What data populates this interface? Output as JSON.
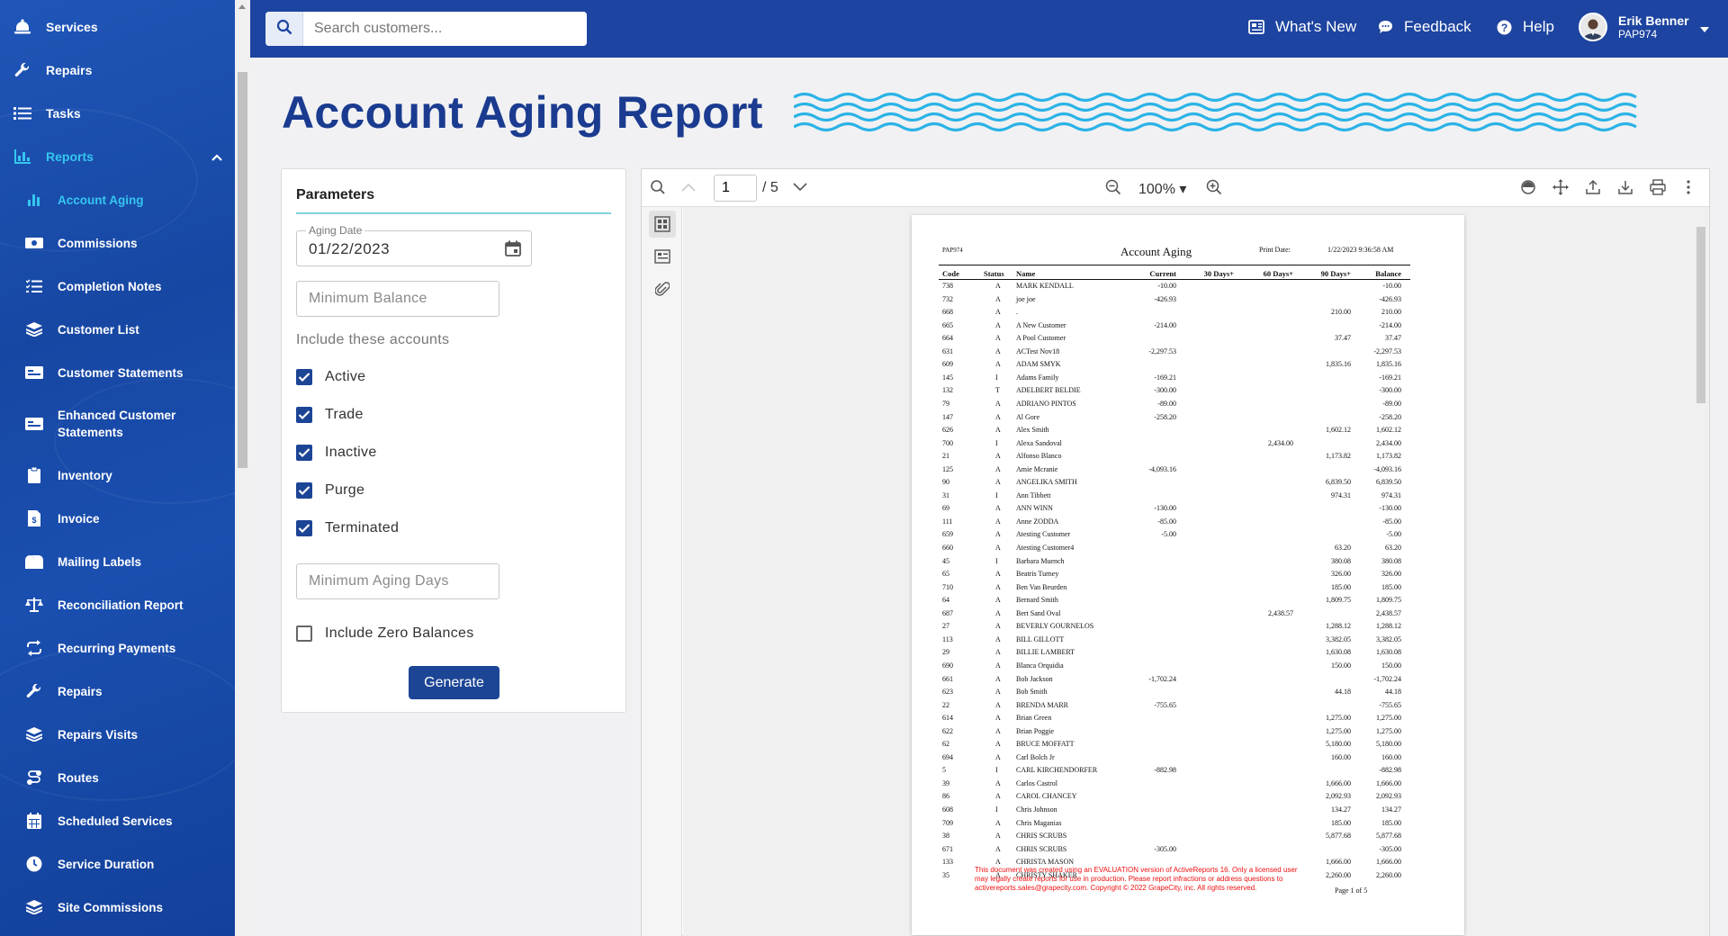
{
  "sidebar": {
    "top_items": [
      {
        "label": "Services",
        "icon": "bell-icon"
      },
      {
        "label": "Repairs",
        "icon": "wrench-icon"
      },
      {
        "label": "Tasks",
        "icon": "list-icon"
      },
      {
        "label": "Reports",
        "icon": "chart-icon"
      }
    ],
    "report_items": [
      {
        "label": "Account Aging"
      },
      {
        "label": "Commissions"
      },
      {
        "label": "Completion Notes"
      },
      {
        "label": "Customer List"
      },
      {
        "label": "Customer Statements"
      },
      {
        "label": "Enhanced Customer Statements"
      },
      {
        "label": "Inventory"
      },
      {
        "label": "Invoice"
      },
      {
        "label": "Mailing Labels"
      },
      {
        "label": "Reconciliation Report"
      },
      {
        "label": "Recurring Payments"
      },
      {
        "label": "Repairs"
      },
      {
        "label": "Repairs Visits"
      },
      {
        "label": "Routes"
      },
      {
        "label": "Scheduled Services"
      },
      {
        "label": "Service Duration"
      },
      {
        "label": "Site Commissions"
      }
    ]
  },
  "header": {
    "search_placeholder": "Search customers...",
    "whats_new": "What's New",
    "feedback": "Feedback",
    "help": "Help",
    "user_name": "Erik Benner",
    "user_code": "PAP974"
  },
  "page_title": "Account Aging Report",
  "params": {
    "title": "Parameters",
    "aging_date_label": "Aging Date",
    "aging_date_value": "01/22/2023",
    "min_balance_placeholder": "Minimum Balance",
    "include_label": "Include these accounts",
    "accounts": [
      {
        "label": "Active",
        "checked": true
      },
      {
        "label": "Trade",
        "checked": true
      },
      {
        "label": "Inactive",
        "checked": true
      },
      {
        "label": "Purge",
        "checked": true
      },
      {
        "label": "Terminated",
        "checked": true
      }
    ],
    "min_aging_days_placeholder": "Minimum Aging Days",
    "include_zero_label": "Include Zero Balances",
    "include_zero_checked": false,
    "generate_label": "Generate"
  },
  "viewer": {
    "page_current": "1",
    "page_total": "/ 5",
    "zoom": "100% ▾"
  },
  "report": {
    "company_code": "PAP974",
    "title": "Account Aging",
    "print_date_label": "Print Date:",
    "print_date_value": "1/22/2023 9:36:58 AM",
    "columns": [
      "Code",
      "Status",
      "Name",
      "Current",
      "30 Days+",
      "60 Days+",
      "90 Days+",
      "Balance"
    ],
    "rows": [
      [
        "738",
        "A",
        "MARK KENDALL",
        "-10.00",
        "",
        "",
        "",
        "-10.00"
      ],
      [
        "732",
        "A",
        "joe joe",
        "-426.93",
        "",
        "",
        "",
        "-426.93"
      ],
      [
        "668",
        "A",
        ".",
        "",
        "",
        "",
        "210.00",
        "210.00"
      ],
      [
        "665",
        "A",
        "A New Customer",
        "-214.00",
        "",
        "",
        "",
        "-214.00"
      ],
      [
        "664",
        "A",
        "A Pool Customer",
        "",
        "",
        "",
        "37.47",
        "37.47"
      ],
      [
        "631",
        "A",
        "ACTest Nov18",
        "-2,297.53",
        "",
        "",
        "",
        "-2,297.53"
      ],
      [
        "609",
        "A",
        "ADAM SMYK",
        "",
        "",
        "",
        "1,835.16",
        "1,835.16"
      ],
      [
        "145",
        "I",
        "Adams Family",
        "-169.21",
        "",
        "",
        "",
        "-169.21"
      ],
      [
        "132",
        "T",
        "ADELBERT BELDIE",
        "-300.00",
        "",
        "",
        "",
        "-300.00"
      ],
      [
        "79",
        "A",
        "ADRIANO PINTOS",
        "-89.00",
        "",
        "",
        "",
        "-89.00"
      ],
      [
        "147",
        "A",
        "Al Gore",
        "-258.20",
        "",
        "",
        "",
        "-258.20"
      ],
      [
        "626",
        "A",
        "Alex Smith",
        "",
        "",
        "",
        "1,602.12",
        "1,602.12"
      ],
      [
        "700",
        "I",
        "Alexa Sandoval",
        "",
        "",
        "2,434.00",
        "",
        "2,434.00"
      ],
      [
        "21",
        "A",
        "Alfonso Blanco",
        "",
        "",
        "",
        "1,173.82",
        "1,173.82"
      ],
      [
        "125",
        "A",
        "Amie Mcranie",
        "-4,093.16",
        "",
        "",
        "",
        "-4,093.16"
      ],
      [
        "90",
        "A",
        "ANGELIKA SMITH",
        "",
        "",
        "",
        "6,839.50",
        "6,839.50"
      ],
      [
        "31",
        "I",
        "Ann Tibbett",
        "",
        "",
        "",
        "974.31",
        "974.31"
      ],
      [
        "69",
        "A",
        "ANN WINN",
        "-130.00",
        "",
        "",
        "",
        "-130.00"
      ],
      [
        "111",
        "A",
        "Anne ZODDA",
        "-85.00",
        "",
        "",
        "",
        "-85.00"
      ],
      [
        "659",
        "A",
        "Atesting Customer",
        "-5.00",
        "",
        "",
        "",
        "-5.00"
      ],
      [
        "660",
        "A",
        "Atesting Customer4",
        "",
        "",
        "",
        "63.20",
        "63.20"
      ],
      [
        "45",
        "I",
        "Barbara Muench",
        "",
        "",
        "",
        "380.08",
        "380.08"
      ],
      [
        "65",
        "A",
        "Beatris Turney",
        "",
        "",
        "",
        "326.00",
        "326.00"
      ],
      [
        "710",
        "A",
        "Ben Van Beurden",
        "",
        "",
        "",
        "185.00",
        "185.00"
      ],
      [
        "64",
        "A",
        "Bernard Smith",
        "",
        "",
        "",
        "1,809.75",
        "1,809.75"
      ],
      [
        "687",
        "A",
        "Bert Sand Oval",
        "",
        "",
        "2,438.57",
        "",
        "2,438.57"
      ],
      [
        "27",
        "A",
        "BEVERLY GOURNELOS",
        "",
        "",
        "",
        "1,288.12",
        "1,288.12"
      ],
      [
        "113",
        "A",
        "BILL GILLOTT",
        "",
        "",
        "",
        "3,382.05",
        "3,382.05"
      ],
      [
        "29",
        "A",
        "BILLIE LAMBERT",
        "",
        "",
        "",
        "1,630.08",
        "1,630.08"
      ],
      [
        "690",
        "A",
        "Blanca Orquidia",
        "",
        "",
        "",
        "150.00",
        "150.00"
      ],
      [
        "661",
        "A",
        "Bob Jackson",
        "-1,702.24",
        "",
        "",
        "",
        "-1,702.24"
      ],
      [
        "623",
        "A",
        "Bob Smith",
        "",
        "",
        "",
        "44.18",
        "44.18"
      ],
      [
        "22",
        "A",
        "BRENDA MARR",
        "-755.65",
        "",
        "",
        "",
        "-755.65"
      ],
      [
        "614",
        "A",
        "Brian Green",
        "",
        "",
        "",
        "1,275.00",
        "1,275.00"
      ],
      [
        "622",
        "A",
        "Brian Poggie",
        "",
        "",
        "",
        "1,275.00",
        "1,275.00"
      ],
      [
        "62",
        "A",
        "BRUCE MOFFATT",
        "",
        "",
        "",
        "5,180.00",
        "5,180.00"
      ],
      [
        "694",
        "A",
        "Carl Bolch Jr",
        "",
        "",
        "",
        "160.00",
        "160.00"
      ],
      [
        "5",
        "I",
        "CARL KIRCHENDORFER",
        "-882.98",
        "",
        "",
        "",
        "-882.98"
      ],
      [
        "39",
        "A",
        "Carlos Castrol",
        "",
        "",
        "",
        "1,666.00",
        "1,666.00"
      ],
      [
        "86",
        "A",
        "CAROL CHANCEY",
        "",
        "",
        "",
        "2,092.93",
        "2,092.93"
      ],
      [
        "608",
        "I",
        "Chris Johnson",
        "",
        "",
        "",
        "134.27",
        "134.27"
      ],
      [
        "709",
        "A",
        "Chris Maganias",
        "",
        "",
        "",
        "185.00",
        "185.00"
      ],
      [
        "38",
        "A",
        "CHRIS SCRUBS",
        "",
        "",
        "",
        "5,877.68",
        "5,877.68"
      ],
      [
        "671",
        "A",
        "CHRIS SCRUBS",
        "-305.00",
        "",
        "",
        "",
        "-305.00"
      ],
      [
        "133",
        "A",
        "CHRISTA MASON",
        "",
        "",
        "",
        "1,666.00",
        "1,666.00"
      ],
      [
        "35",
        "A",
        "CHRISTY SHAKER",
        "",
        "",
        "",
        "2,260.00",
        "2,260.00"
      ]
    ],
    "eval_notice": "This document was created using an EVALUATION version of ActiveReports 16. Only a licensed user may legally create reports for use in production. Please report infractions or address questions to activereports.sales@grapecity.com. Copyright © 2022 GrapeCity, inc. All rights reserved.",
    "page_footer": "Page  1  of   5"
  },
  "colors": {
    "sidebar_bg": "#1a4fb0",
    "header_bg": "#1d44a0",
    "title_color": "#1a3b8f",
    "active_link": "#35c6f0",
    "primary_button": "#1d4596",
    "wave_color": "#2bb3e6"
  }
}
